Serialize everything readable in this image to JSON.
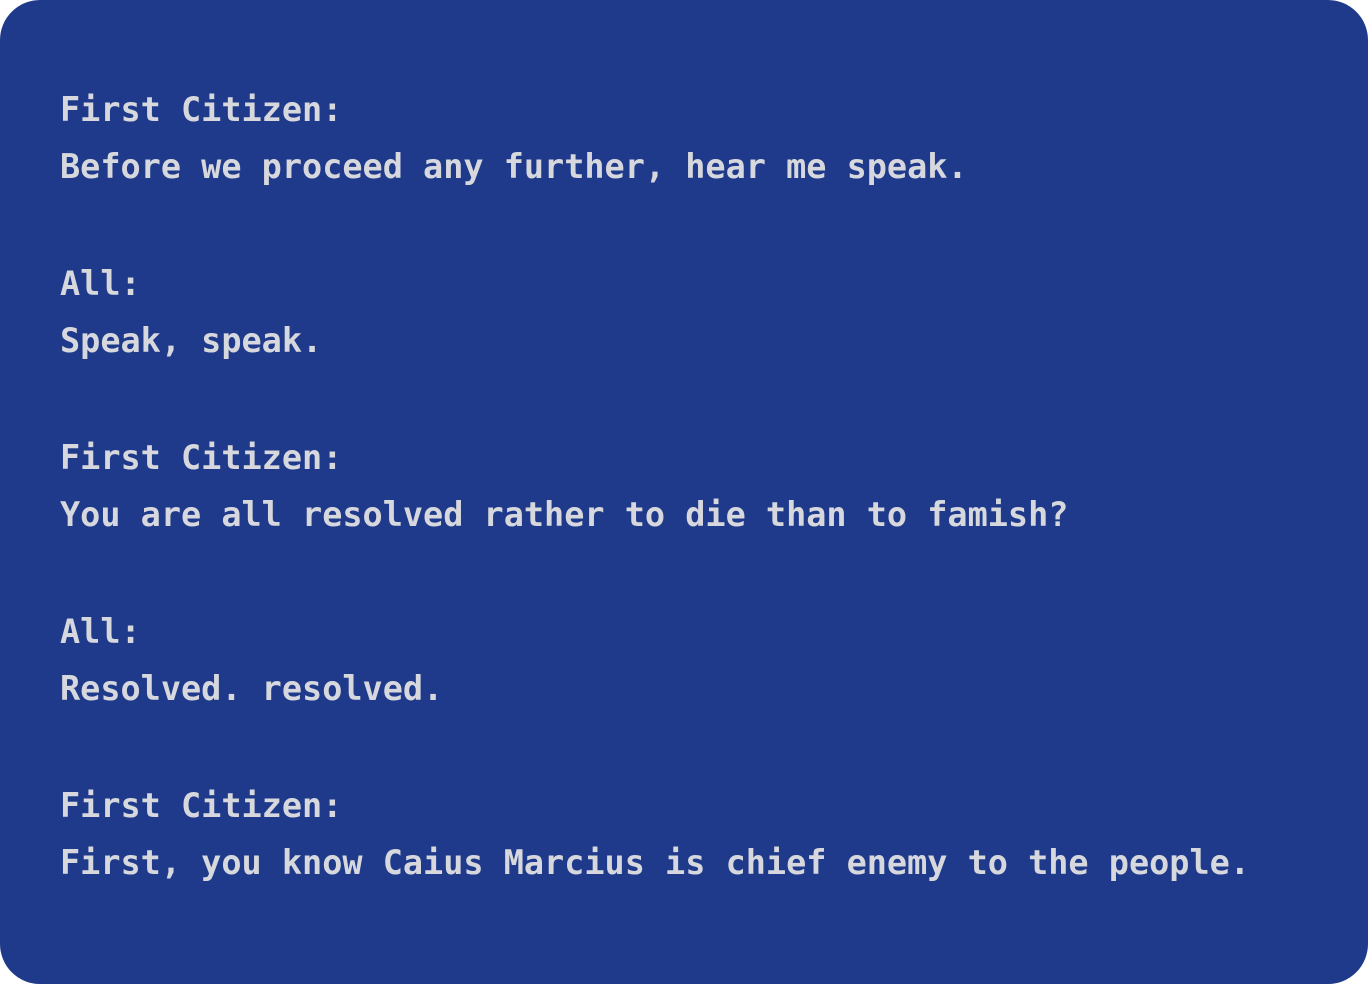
{
  "dialogue": [
    {
      "speaker": "First Citizen:",
      "line": "Before we proceed any further, hear me speak."
    },
    {
      "speaker": "All:",
      "line": "Speak, speak."
    },
    {
      "speaker": "First Citizen:",
      "line": "You are all resolved rather to die than to famish?"
    },
    {
      "speaker": "All:",
      "line": "Resolved. resolved."
    },
    {
      "speaker": "First Citizen:",
      "line": "First, you know Caius Marcius is chief enemy to the people."
    }
  ],
  "colors": {
    "background": "#1f3a8a",
    "text": "#d6d8de"
  }
}
